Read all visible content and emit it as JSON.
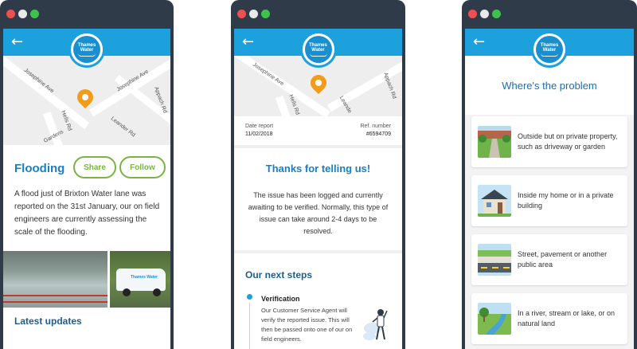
{
  "phone1": {
    "map_streets": [
      "Josephine Ave",
      "Josephine Ave",
      "Hells Rd",
      "Appach Rd",
      "Leander Rd",
      "Gardens"
    ],
    "title": "Flooding",
    "share_label": "Share",
    "follow_label": "Follow",
    "description": "A flood just of Brixton Water lane was reported on the 31st January, our on field engineers are currently assessing the scale of the flooding.",
    "van_text": "Thames Water",
    "latest_updates": "Latest updates"
  },
  "phone2": {
    "map_streets": [
      "Josephine Ave",
      "Hells Rd",
      "Appach Rd",
      "Leande"
    ],
    "date_label": "Date report",
    "date_value": "11/02/2018",
    "ref_label": "Ref. number",
    "ref_value": "#6594709",
    "thanks_title": "Thanks for telling us!",
    "thanks_body": "The issue has been logged and currently awaiting to be verified. Normally, this type of issue can take around 2-4 days to be resolved.",
    "steps_title": "Our next steps",
    "step_title": "Verification",
    "step_body": "Our Customer Service Agent will verify the reported issue. This will then be passed onto one of our on field engineers."
  },
  "phone3": {
    "title": "Where's the problem",
    "options": [
      {
        "label": "Outside but on private property, such as driveway or garden",
        "icon": "garden-illustration"
      },
      {
        "label": "Inside my home or in a private building",
        "icon": "house-illustration"
      },
      {
        "label": "Street, pavement or another public area",
        "icon": "street-illustration"
      },
      {
        "label": "In a river, stream or lake, or on natural land",
        "icon": "river-illustration"
      }
    ]
  },
  "logo": {
    "line1": "Thames",
    "line2": "Water"
  },
  "colors": {
    "brand_blue": "#1ca1dc",
    "accent_green": "#7cb342",
    "pin_orange": "#f39c1c",
    "frame": "#2f3b48"
  }
}
